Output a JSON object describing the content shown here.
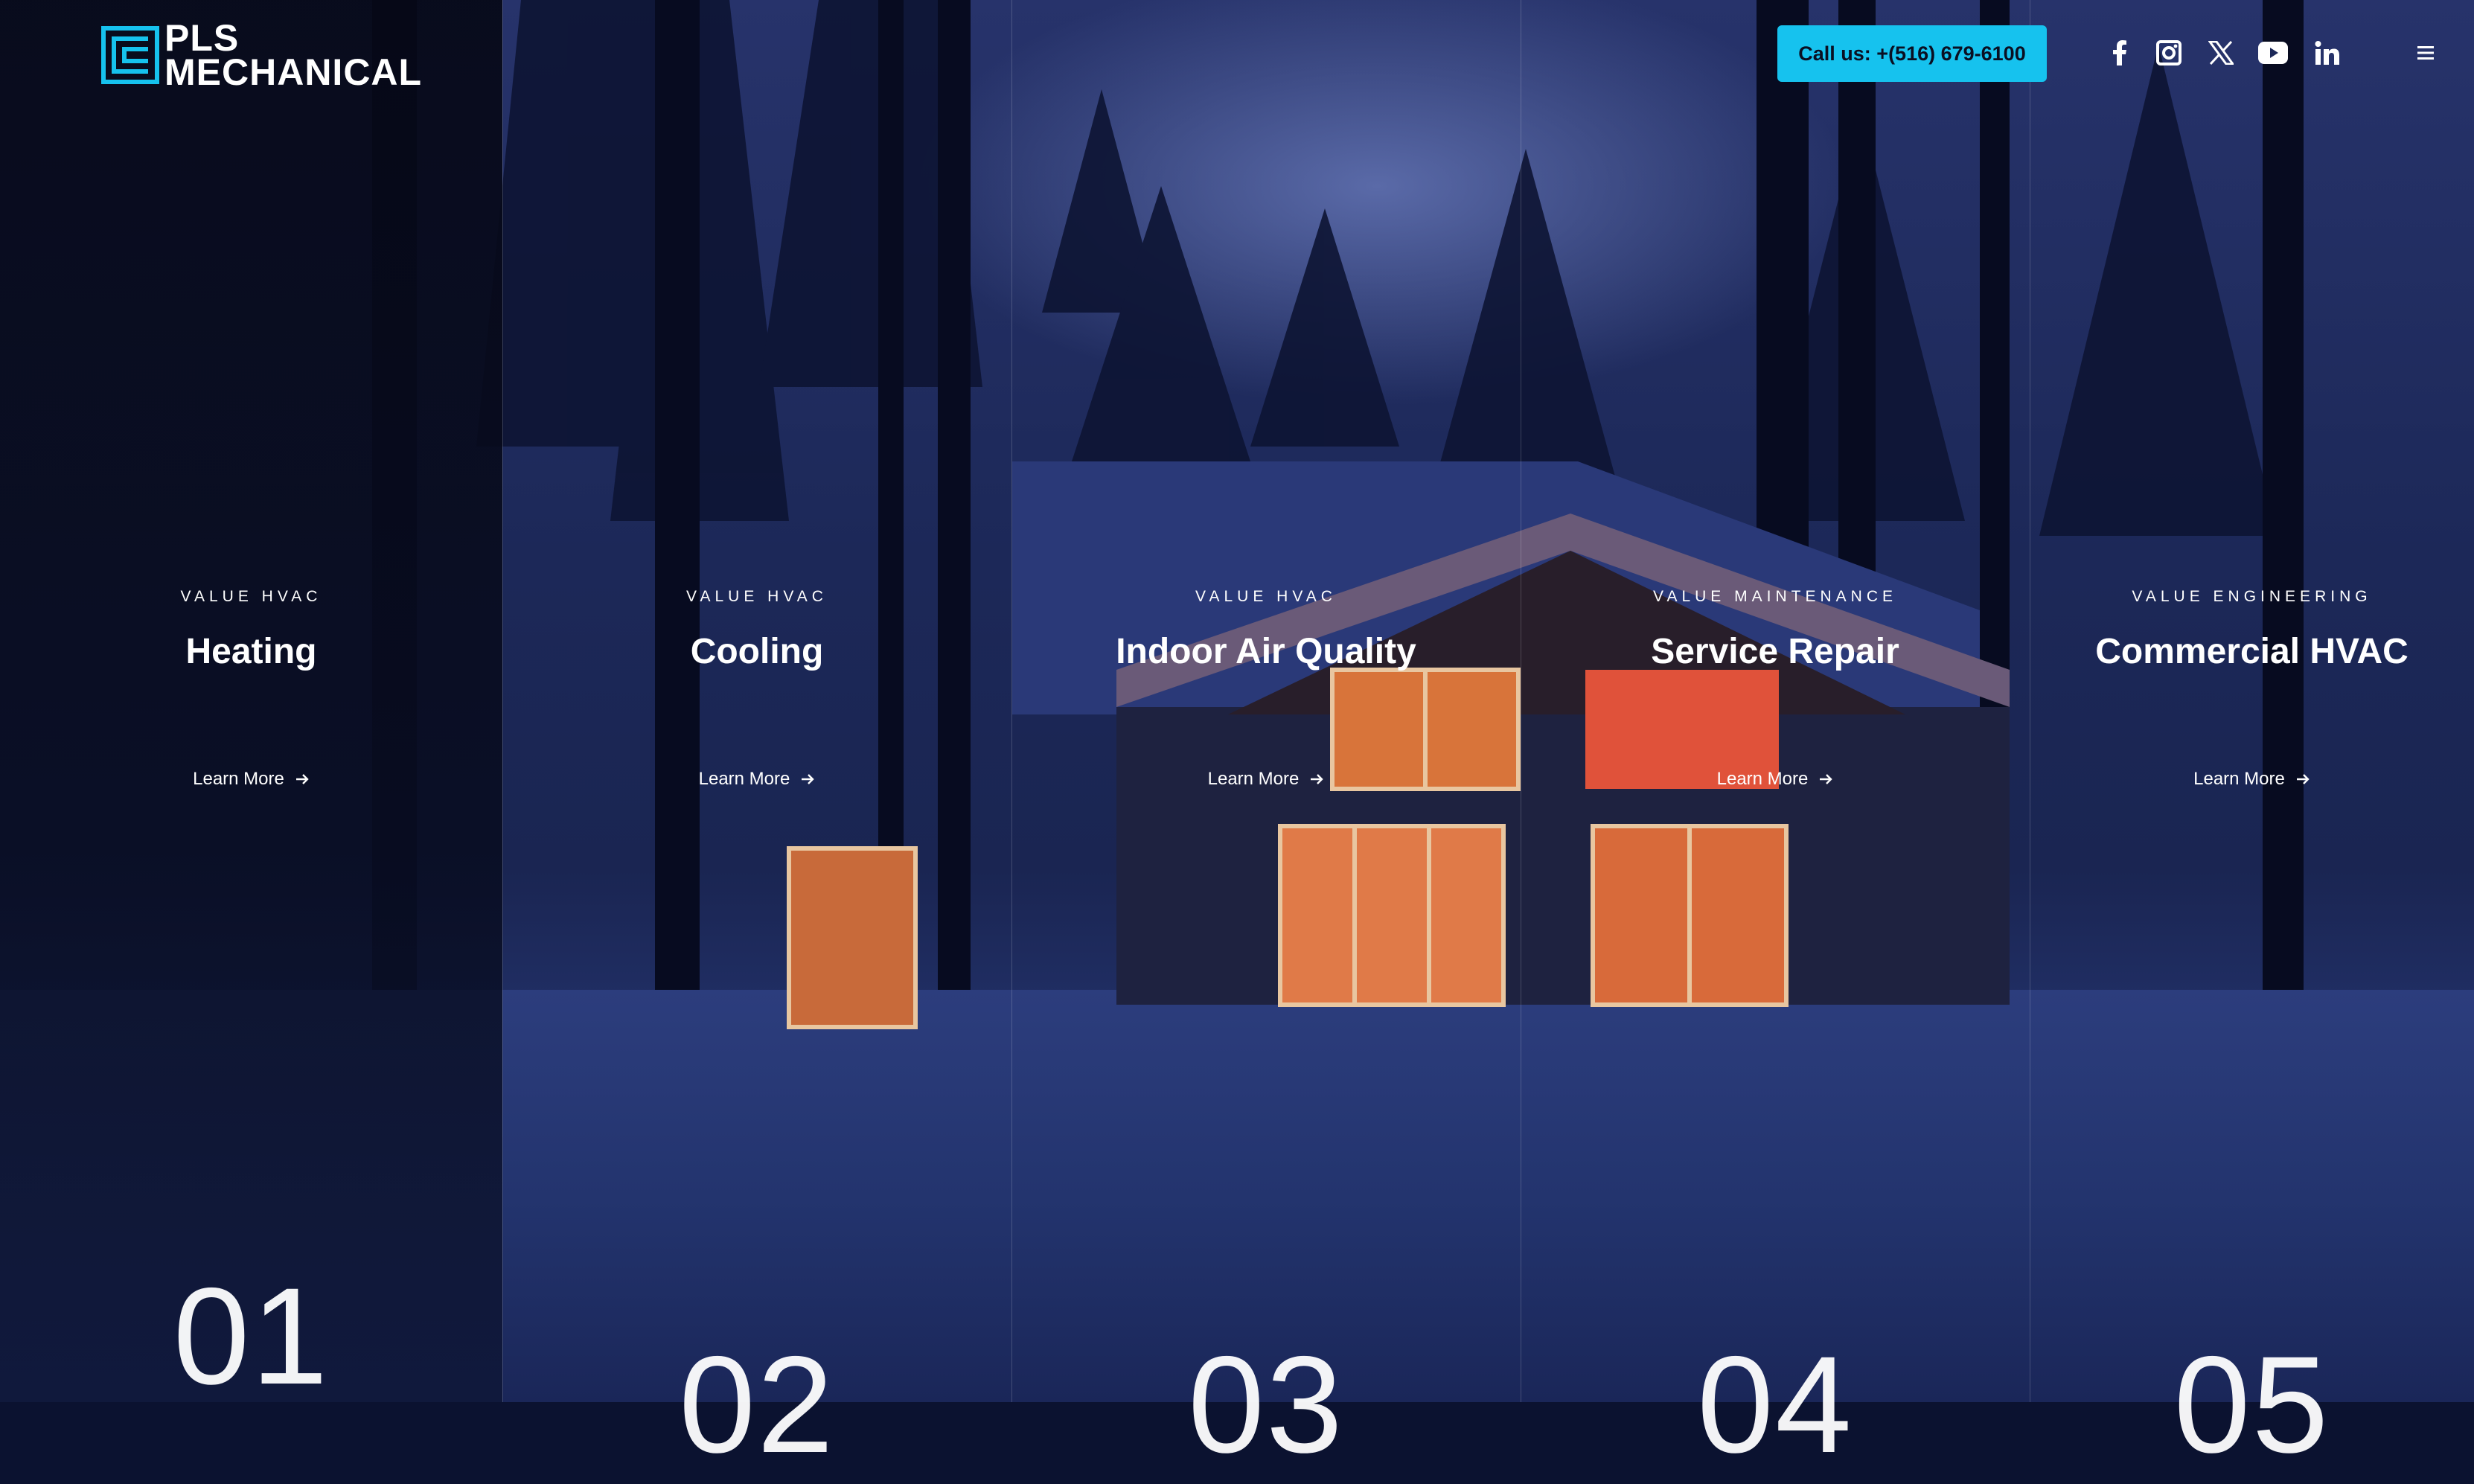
{
  "header": {
    "logo_line1": "PLS",
    "logo_line2": "MECHANICAL",
    "call_label": "Call us: +(516) 679-6100",
    "socials": [
      "facebook-icon",
      "instagram-icon",
      "x-icon",
      "youtube-icon",
      "linkedin-icon"
    ],
    "menu_icon": "hamburger-menu-icon"
  },
  "colors": {
    "accent": "#16c2ee",
    "text": "#ffffff"
  },
  "services": [
    {
      "eyebrow": "VALUE HVAC",
      "title": "Heating",
      "link": "Learn More",
      "number": "01"
    },
    {
      "eyebrow": "VALUE HVAC",
      "title": "Cooling",
      "link": "Learn More",
      "number": "02"
    },
    {
      "eyebrow": "VALUE HVAC",
      "title": "Indoor Air Quality",
      "link": "Learn More",
      "number": "03"
    },
    {
      "eyebrow": "VALUE MAINTENANCE",
      "title": "Service Repair",
      "link": "Learn More",
      "number": "04"
    },
    {
      "eyebrow": "VALUE ENGINEERING",
      "title": "Commercial HVAC",
      "link": "Learn More",
      "number": "05"
    }
  ]
}
